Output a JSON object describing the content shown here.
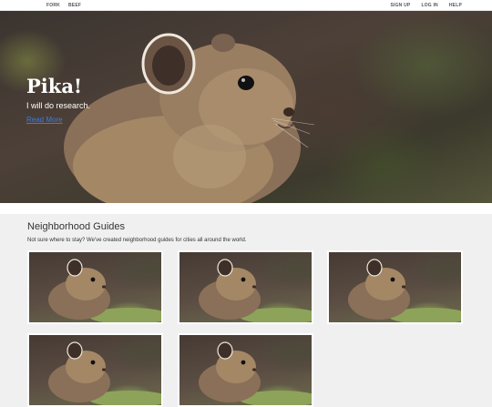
{
  "nav": {
    "left_items": [
      "FORK",
      "BEEF"
    ],
    "right_items": [
      "SIGN UP",
      "LOG IN",
      "HELP"
    ]
  },
  "hero": {
    "title": "Pika!",
    "tagline": "I will do research.",
    "link_text": "Read More"
  },
  "guides": {
    "heading": "Neighborhood Guides",
    "description": "Not sure where to stay? We've created neighborhood guides for cities all around the world.",
    "cards": [
      "pika-photo",
      "pika-photo",
      "pika-photo",
      "pika-photo",
      "pika-photo"
    ]
  }
}
